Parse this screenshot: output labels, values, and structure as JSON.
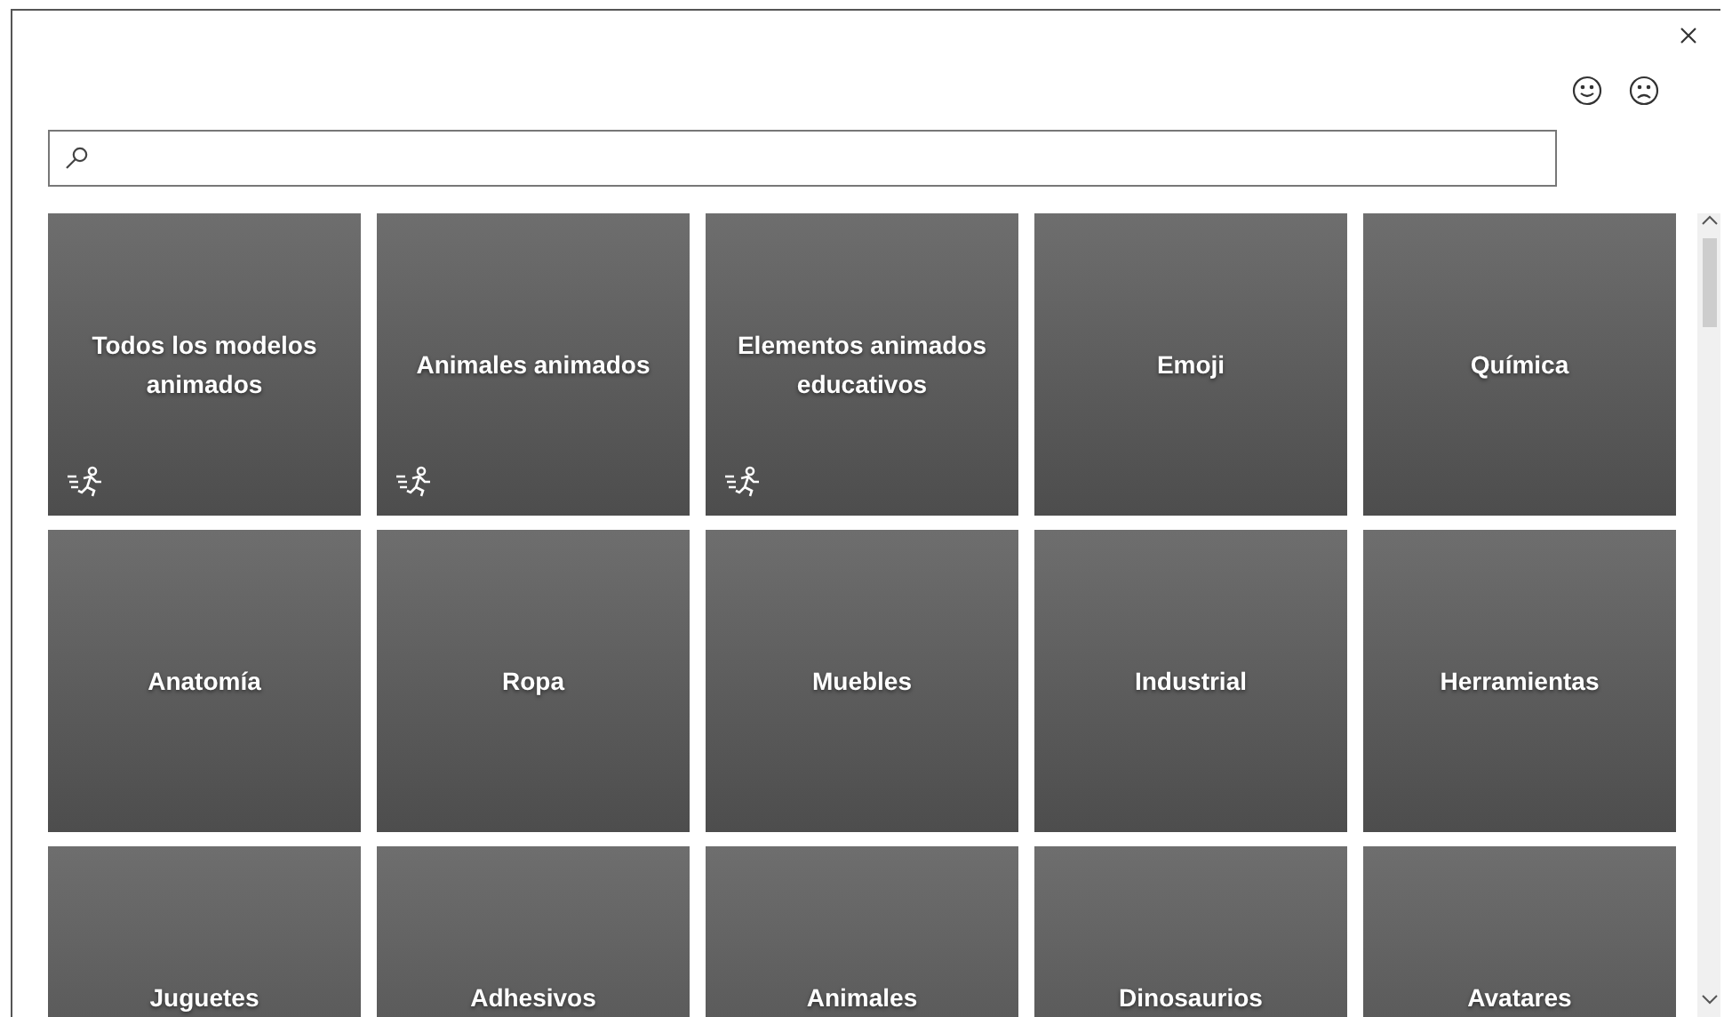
{
  "feedback": [
    {
      "kind": "smile"
    },
    {
      "kind": "frown"
    }
  ],
  "categories": [
    {
      "label": "Todos los modelos animados",
      "animated": true
    },
    {
      "label": "Animales animados",
      "animated": true
    },
    {
      "label": "Elementos animados educativos",
      "animated": true
    },
    {
      "label": "Emoji",
      "animated": false
    },
    {
      "label": "Química",
      "animated": false
    },
    {
      "label": "Anatomía",
      "animated": false
    },
    {
      "label": "Ropa",
      "animated": false
    },
    {
      "label": "Muebles",
      "animated": false
    },
    {
      "label": "Industrial",
      "animated": false
    },
    {
      "label": "Herramientas",
      "animated": false
    },
    {
      "label": "Juguetes",
      "animated": false
    },
    {
      "label": "Adhesivos",
      "animated": false
    },
    {
      "label": "Animales",
      "animated": false
    },
    {
      "label": "Dinosaurios",
      "animated": false
    },
    {
      "label": "Avatares",
      "animated": false
    }
  ]
}
